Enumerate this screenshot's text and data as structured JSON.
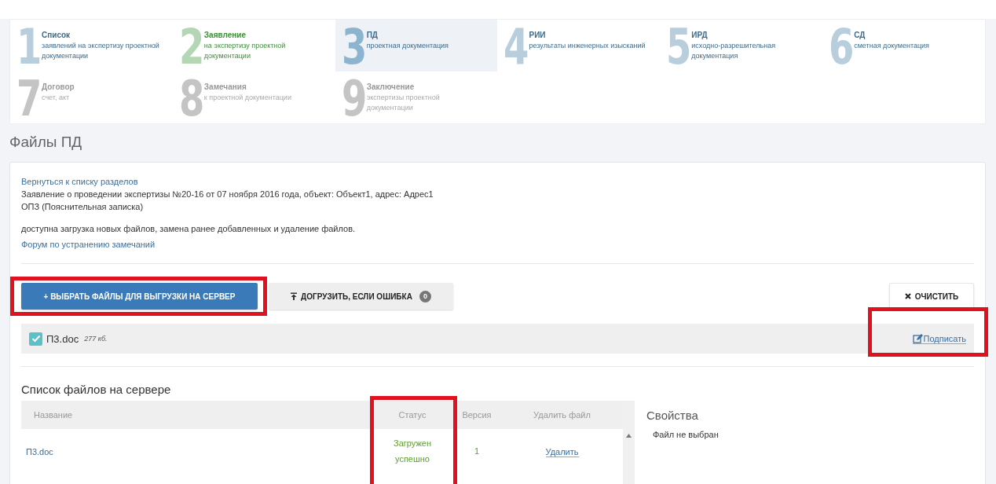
{
  "steps": [
    {
      "number": "1",
      "title": "Список",
      "subtitle": "заявлений на экспертизу проектной документации",
      "selected": false,
      "completed": false,
      "disabled": false
    },
    {
      "number": "2",
      "title": "Заявление",
      "subtitle": "на экспертизу проектной документации",
      "selected": false,
      "completed": true,
      "disabled": false
    },
    {
      "number": "3",
      "title": "ПД",
      "subtitle": "проектная документация",
      "selected": true,
      "completed": false,
      "disabled": false
    },
    {
      "number": "4",
      "title": "РИИ",
      "subtitle": "результаты инженерных изысканий",
      "selected": false,
      "completed": false,
      "disabled": false
    },
    {
      "number": "5",
      "title": "ИРД",
      "subtitle": "исходно-разрешительная документация",
      "selected": false,
      "completed": false,
      "disabled": false
    },
    {
      "number": "6",
      "title": "СД",
      "subtitle": "сметная документация",
      "selected": false,
      "completed": false,
      "disabled": false
    },
    {
      "number": "7",
      "title": "Договор",
      "subtitle": "счет, акт",
      "selected": false,
      "completed": false,
      "disabled": true
    },
    {
      "number": "8",
      "title": "Замечания",
      "subtitle": "к проектной документации",
      "selected": false,
      "completed": false,
      "disabled": true
    },
    {
      "number": "9",
      "title": "Заключение",
      "subtitle": "экспертизы проектной документации",
      "selected": false,
      "completed": false,
      "disabled": true
    }
  ],
  "page_title": "Файлы ПД",
  "card": {
    "back_link": "Вернуться к списку разделов",
    "application": "Заявление о проведении экспертизы №20-16 от 07 ноября 2016 года, объект: Объект1, адрес: Адрес1",
    "section": "ОПЗ (Пояснительная записка)",
    "permissions": "доступна загрузка новых файлов, замена ранее добавленных и удаление файлов.",
    "forum_link": "Форум по устранению замечаний"
  },
  "toolbar": {
    "choose_button": {
      "label": "+ ВЫБРАТЬ ФАЙЛЫ ДЛЯ ВЫГРУЗКИ НА СЕРВЕР",
      "highlighted": true
    },
    "retry_button": {
      "label": "ДОГРУЗИТЬ, ЕСЛИ ОШИБКА",
      "count": "0"
    },
    "clear_button": {
      "label": "ОЧИСТИТЬ"
    }
  },
  "upload": {
    "checked": true,
    "filename": "П3.doc",
    "size": "277 кб.",
    "sign_link": "Подписать",
    "highlighted": true
  },
  "server_files": {
    "title": "Список файлов на сервере",
    "columns": [
      {
        "label": "Название",
        "highlighted": false
      },
      {
        "label": "Статус",
        "highlighted": true
      },
      {
        "label": "Версия",
        "highlighted": false
      },
      {
        "label": "Удалить файл",
        "highlighted": false
      }
    ],
    "rows": [
      {
        "name": "П3.doc",
        "status": "Загружен успешно",
        "version": "1",
        "action": "Удалить"
      }
    ]
  },
  "properties": {
    "title": "Свойства",
    "message": "Файл не выбран"
  }
}
